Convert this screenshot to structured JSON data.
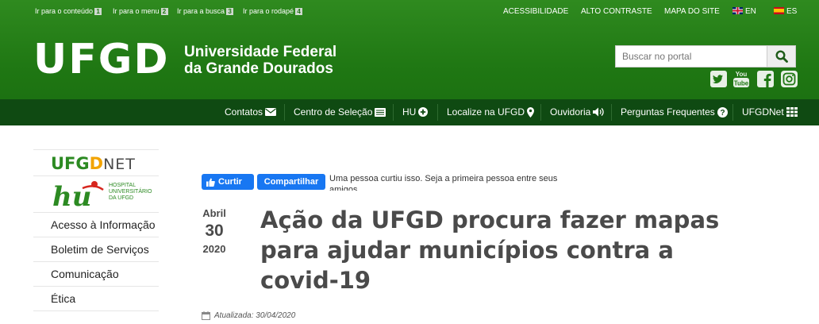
{
  "skip_links": [
    {
      "label": "Ir para o conteúdo",
      "key": "1"
    },
    {
      "label": "Ir para o menu",
      "key": "2"
    },
    {
      "label": "Ir para a busca",
      "key": "3"
    },
    {
      "label": "Ir para o rodapé",
      "key": "4"
    }
  ],
  "top_links": {
    "accessibility": "ACESSIBILIDADE",
    "high_contrast": "ALTO CONTRASTE",
    "sitemap": "MAPA DO SITE",
    "lang_en": "EN",
    "lang_es": "ES"
  },
  "brand": {
    "logo": "UFGD",
    "name_line1": "Universidade Federal",
    "name_line2": "da Grande Dourados"
  },
  "search": {
    "placeholder": "Buscar no portal"
  },
  "social": [
    "twitter-icon",
    "youtube-icon",
    "facebook-icon",
    "instagram-icon"
  ],
  "nav": [
    {
      "label": "Contatos",
      "icon": "envelope-icon"
    },
    {
      "label": "Centro de Seleção",
      "icon": "list-icon"
    },
    {
      "label": "HU",
      "icon": "plus-circle-icon"
    },
    {
      "label": "Localize na UFGD",
      "icon": "map-marker-icon"
    },
    {
      "label": "Ouvidoria",
      "icon": "speaker-icon"
    },
    {
      "label": "Perguntas Frequentes",
      "icon": "question-circle-icon"
    },
    {
      "label": "UFGDNet",
      "icon": "grid-icon"
    }
  ],
  "sidebar": {
    "ufgdnet_logo": {
      "ufg": "UFG",
      "d": "D",
      "net": "NET"
    },
    "hu_logo": {
      "mark": "hu",
      "line1": "HOSPITAL",
      "line2": "UNIVERSITÁRIO",
      "line3": "DA UFGD"
    },
    "items": [
      "Acesso à Informação",
      "Boletim de Serviços",
      "Comunicação",
      "Ética"
    ]
  },
  "facebook": {
    "like": "Curtir",
    "share": "Compartilhar",
    "text": "Uma pessoa curtiu isso. Seja a primeira pessoa entre seus amigos."
  },
  "article": {
    "month": "Abril",
    "day": "30",
    "year": "2020",
    "title": "Ação da UFGD procura fazer mapas para ajudar municípios contra a covid-19",
    "updated": "Atualizada: 30/04/2020"
  },
  "colors": {
    "header_green": "#1f7713",
    "nav_dark_green": "#0f4a12",
    "facebook_blue": "#1877f2"
  }
}
